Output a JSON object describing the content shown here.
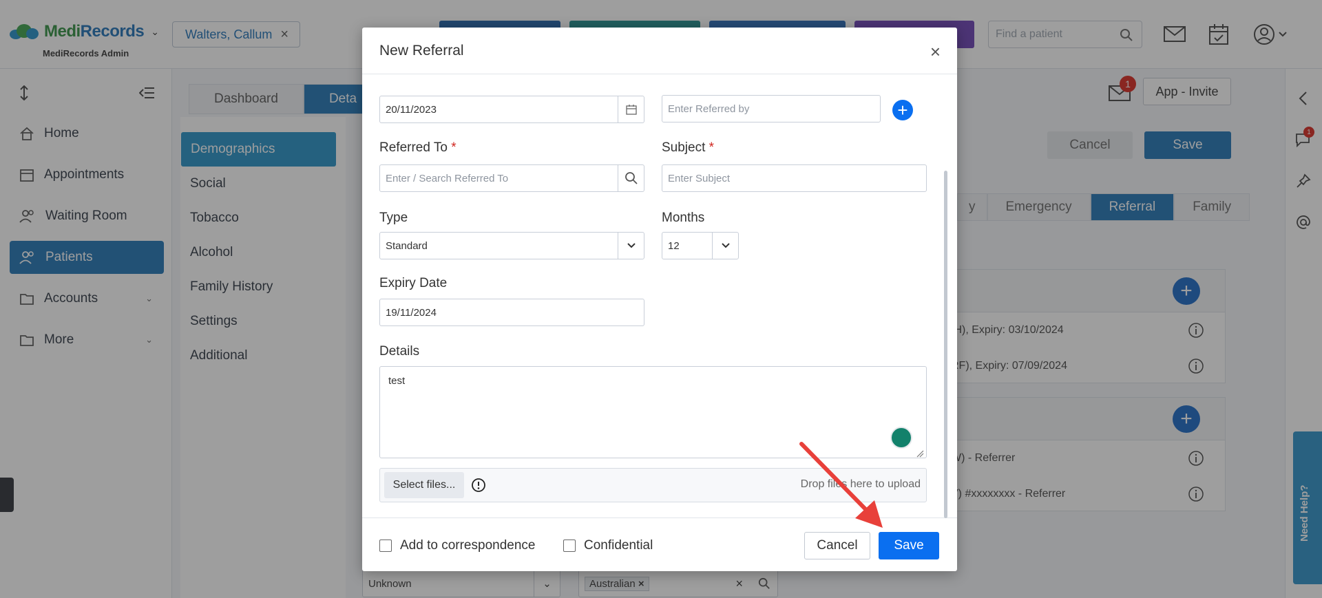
{
  "app": {
    "brand_medi": "Medi",
    "brand_records": "Records",
    "subtitle": "MediRecords Admin"
  },
  "header": {
    "patient_chip": "Walters, Callum",
    "search_placeholder": "Find a patient",
    "notification_count": "1"
  },
  "sidebar": {
    "items": [
      {
        "label": "Home"
      },
      {
        "label": "Appointments"
      },
      {
        "label": "Waiting Room"
      },
      {
        "label": "Patients"
      },
      {
        "label": "Accounts"
      },
      {
        "label": "More"
      }
    ]
  },
  "page_tabs": [
    "Dashboard",
    "Deta"
  ],
  "left_menu": [
    "Demographics",
    "Social",
    "Tobacco",
    "Alcohol",
    "Family History",
    "Settings",
    "Additional"
  ],
  "right": {
    "app_invite": "App - Invite",
    "cancel": "Cancel",
    "save": "Save",
    "subtabs": [
      "y",
      "Emergency",
      "Referral",
      "Family"
    ],
    "referral_rows": [
      "IH), Expiry: 03/10/2024",
      "RF), Expiry: 07/09/2024"
    ],
    "referrer_rows": [
      "W) - Referrer",
      "V) #xxxxxxxx - Referrer"
    ],
    "badge_count": "1"
  },
  "bottom": {
    "select_value": "Unknown",
    "tag_value": "Australian"
  },
  "modal": {
    "title": "New Referral",
    "referral_date": "20/11/2023",
    "referred_by_placeholder": "Enter Referred by",
    "referred_to_label": "Referred To",
    "referred_to_placeholder": "Enter / Search Referred To",
    "subject_label": "Subject",
    "subject_placeholder": "Enter Subject",
    "type_label": "Type",
    "type_value": "Standard",
    "months_label": "Months",
    "months_value": "12",
    "expiry_label": "Expiry Date",
    "expiry_value": "19/11/2024",
    "details_label": "Details",
    "details_value": "test",
    "select_files": "Select files...",
    "drop_text": "Drop files here to upload",
    "add_to_correspondence": "Add to correspondence",
    "confidential": "Confidential",
    "cancel": "Cancel",
    "save": "Save",
    "required_mark": "*"
  },
  "help": {
    "need_help": "Need Help?"
  },
  "colors": {
    "primary": "#1e73b5",
    "save_button": "#0a6ff0",
    "annotation_arrow": "#e8403a",
    "required": "#d0261f"
  }
}
